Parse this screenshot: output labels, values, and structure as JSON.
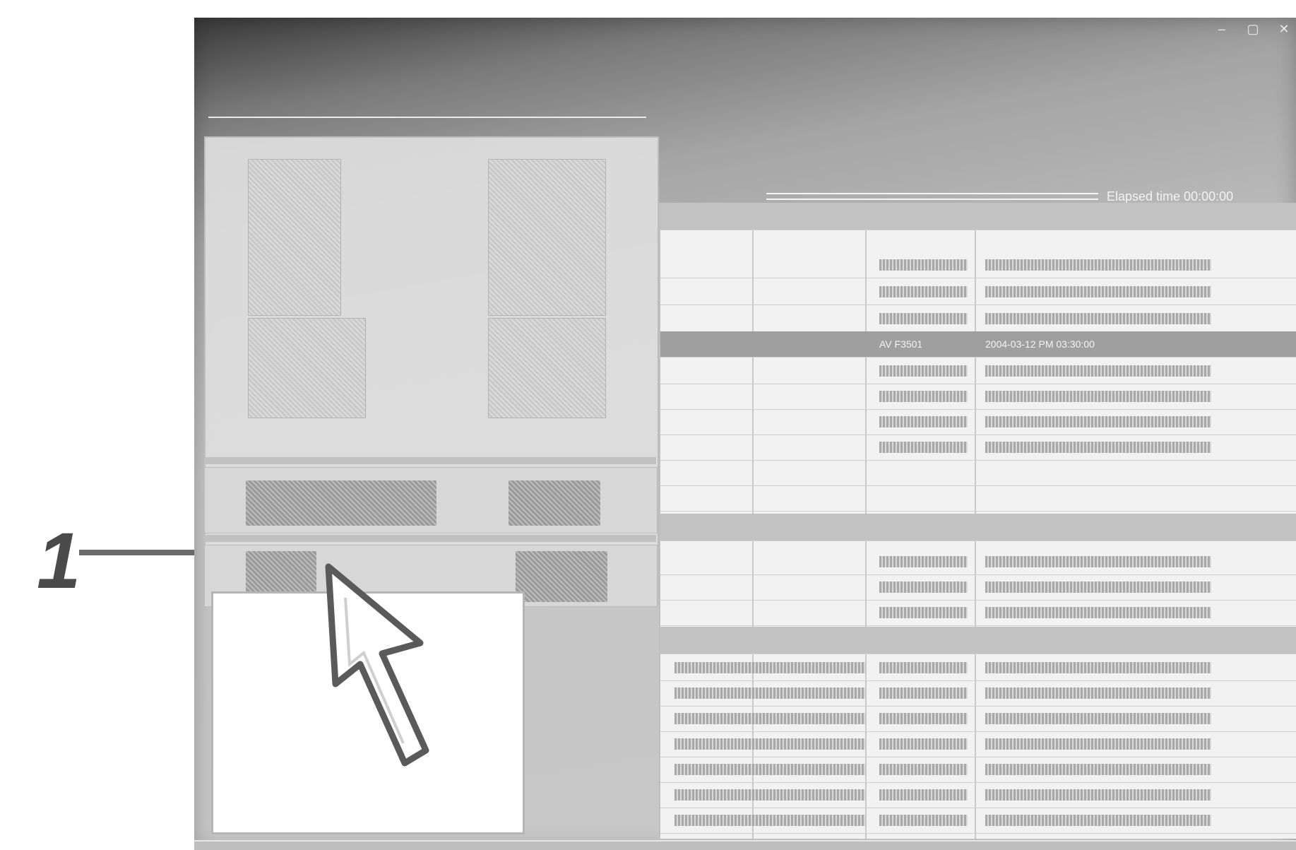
{
  "callout": {
    "number": "1"
  },
  "window": {
    "controls": [
      "–",
      "▢",
      "✕"
    ]
  },
  "device_panel": {
    "header": ""
  },
  "elapsed": {
    "text": "Elapsed time 00:00:00"
  },
  "file_table": {
    "selected_row": {
      "col2": "AV F3501",
      "col3": "2004-03-12 PM 03:30:00"
    }
  },
  "icons": {
    "cursor": "arrow-cursor-icon"
  }
}
